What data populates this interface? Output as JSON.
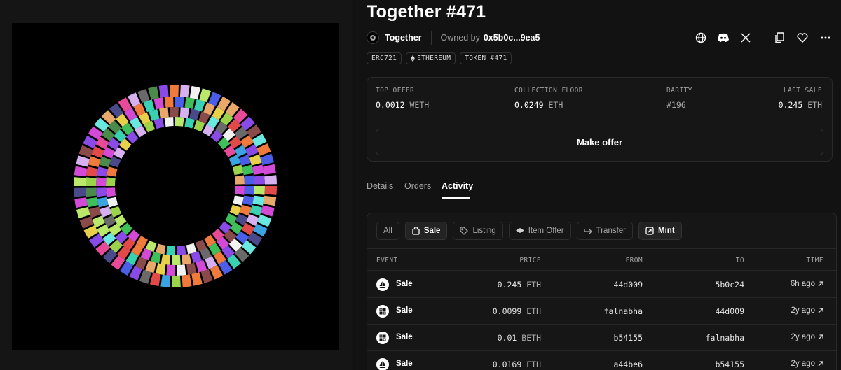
{
  "nft": {
    "title": "Together #471",
    "collection_name": "Together",
    "owned_label": "Owned by",
    "owner_address": "0x5b0c...9ea5"
  },
  "header_icons": [
    "globe-icon",
    "discord-icon",
    "x-icon",
    "copy-icon",
    "heart-icon",
    "more-icon"
  ],
  "tags": [
    {
      "label": "ERC721",
      "icon": null
    },
    {
      "label": "ETHEREUM",
      "icon": "ethereum-icon"
    },
    {
      "label": "TOKEN #471",
      "icon": null
    }
  ],
  "stats": {
    "top_offer": {
      "label": "TOP OFFER",
      "value": "0.0012",
      "unit": "WETH"
    },
    "collection_floor": {
      "label": "COLLECTION FLOOR",
      "value": "0.0249",
      "unit": "ETH"
    },
    "rarity": {
      "label": "RARITY",
      "value": "#196"
    },
    "last_sale": {
      "label": "LAST SALE",
      "value": "0.245",
      "unit": "ETH"
    }
  },
  "make_offer_label": "Make offer",
  "tabs": [
    {
      "label": "Details",
      "active": false
    },
    {
      "label": "Orders",
      "active": false
    },
    {
      "label": "Activity",
      "active": true
    }
  ],
  "filters": [
    {
      "label": "All",
      "selected": false,
      "icon": null
    },
    {
      "label": "Sale",
      "selected": true,
      "icon": "bag-icon"
    },
    {
      "label": "Listing",
      "selected": false,
      "icon": "tag-icon"
    },
    {
      "label": "Item Offer",
      "selected": false,
      "icon": "layers-icon"
    },
    {
      "label": "Transfer",
      "selected": false,
      "icon": "transfer-icon"
    },
    {
      "label": "Mint",
      "selected": true,
      "icon": "mint-icon"
    }
  ],
  "table": {
    "headers": {
      "event": "EVENT",
      "price": "PRICE",
      "from": "FROM",
      "to": "TO",
      "time": "TIME"
    },
    "rows": [
      {
        "event": "Sale",
        "marketplace_icon": "opensea-icon",
        "price": "0.245",
        "unit": "ETH",
        "from": "44d009",
        "to": "5b0c24",
        "time": "6h ago"
      },
      {
        "event": "Sale",
        "marketplace_icon": "blur-icon",
        "price": "0.0099",
        "unit": "ETH",
        "from": "falnabha",
        "to": "44d009",
        "time": "2y ago"
      },
      {
        "event": "Sale",
        "marketplace_icon": "blur-icon",
        "price": "0.01",
        "unit": "BETH",
        "from": "b54155",
        "to": "falnabha",
        "time": "2y ago"
      },
      {
        "event": "Sale",
        "marketplace_icon": "opensea-icon",
        "price": "0.0169",
        "unit": "ETH",
        "from": "a44be6",
        "to": "b54155",
        "time": "2y ago"
      }
    ]
  },
  "colors": {
    "background": "#121212",
    "card": "#161616",
    "border": "#2a2a2a",
    "muted_text": "#a0a0a0"
  }
}
